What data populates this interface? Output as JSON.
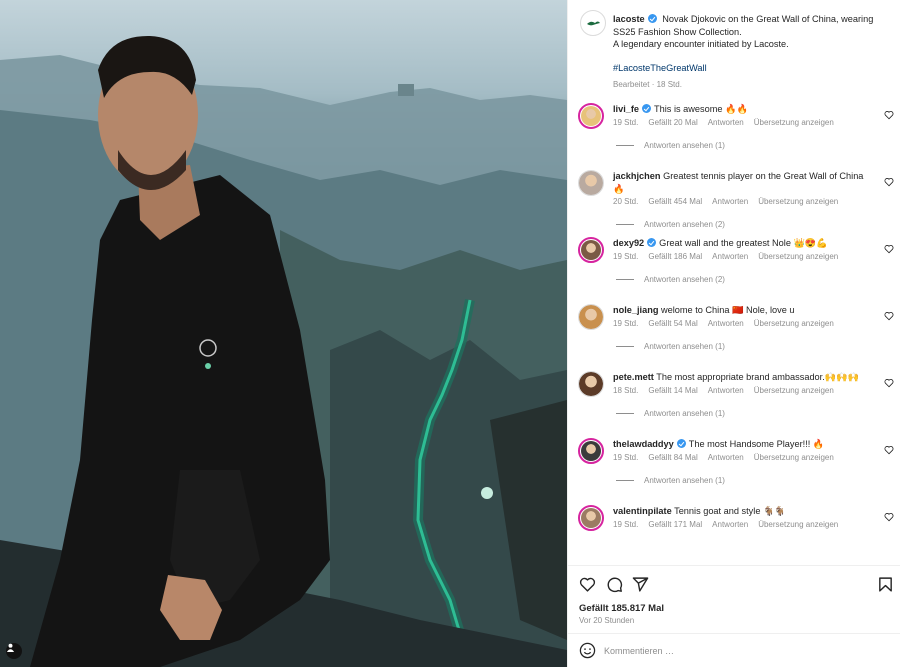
{
  "post": {
    "image_alt": "Man in black jacket sitting on the Great Wall of China",
    "tag_icon": "user-icon",
    "author": "lacoste",
    "caption_line1": "Novak Djokovic on the Great Wall of China, wearing",
    "caption_line2": "SS25 Fashion Show Collection.",
    "caption_line3": "A legendary encounter initiated by Lacoste.",
    "hashtag": "#LacosteTheGreatWall",
    "edited": "Bearbeitet · 18 Std."
  },
  "labels": {
    "reply": "Antworten",
    "translate": "Übersetzung anzeigen"
  },
  "comments": [
    {
      "user": "livi_fe",
      "verified": true,
      "text": "This is awesome 🔥🔥",
      "text2": "",
      "time": "19 Std.",
      "likes": "Gefällt 20 Mal",
      "replies": "Antworten ansehen (1)",
      "avatar_color": "#e7c27a",
      "ring": true
    },
    {
      "user": "jackhjchen",
      "verified": false,
      "text": "Greatest tennis player on the Great Wall of China",
      "text2": "🔥",
      "time": "20 Std.",
      "likes": "Gefällt 454 Mal",
      "replies": "Antworten ansehen (2)",
      "avatar_color": "#b9aaa0",
      "ring": false
    },
    {
      "user": "dexy92",
      "verified": true,
      "text": "Great wall and the greatest Nole 👑😍💪",
      "text2": "",
      "time": "19 Std.",
      "likes": "Gefällt 186 Mal",
      "replies": "Antworten ansehen (2)",
      "avatar_color": "#7a5a44",
      "ring": true
    },
    {
      "user": "nole_jiang",
      "verified": false,
      "text": "welome to China 🇨🇳 Nole, love u",
      "text2": "",
      "time": "19 Std.",
      "likes": "Gefällt 54 Mal",
      "replies": "Antworten ansehen (1)",
      "avatar_color": "#c9904e",
      "ring": false
    },
    {
      "user": "pete.mett",
      "verified": false,
      "text": "The most appropriate brand ambassador.🙌🙌🙌",
      "text2": "",
      "time": "18 Std.",
      "likes": "Gefällt 14 Mal",
      "replies": "Antworten ansehen (1)",
      "avatar_color": "#5c3b28",
      "ring": false
    },
    {
      "user": "thelawdaddyy",
      "verified": true,
      "text": "The most Handsome Player!!! 🔥",
      "text2": "",
      "time": "19 Std.",
      "likes": "Gefällt 84 Mal",
      "replies": "Antworten ansehen (1)",
      "avatar_color": "#3b3b3b",
      "ring": true
    },
    {
      "user": "valentinpilate",
      "verified": false,
      "text": "Tennis goat and style 🐐🐐",
      "text2": "",
      "time": "19 Std.",
      "likes": "Gefällt 171 Mal",
      "replies": "",
      "avatar_color": "#9b7b62",
      "ring": true
    }
  ],
  "actions": {
    "like_icon": "heart-icon",
    "comment_icon": "comment-icon",
    "share_icon": "share-icon",
    "save_icon": "bookmark-icon",
    "likes_total": "Gefällt 185.817 Mal",
    "posted": "Vor 20 Stunden"
  },
  "composer": {
    "emoji_icon": "emoji-icon",
    "placeholder": "Kommentieren …"
  },
  "colors": {
    "link": "#00376b",
    "verified": "#3897f0",
    "muted": "#8e8e8e"
  }
}
